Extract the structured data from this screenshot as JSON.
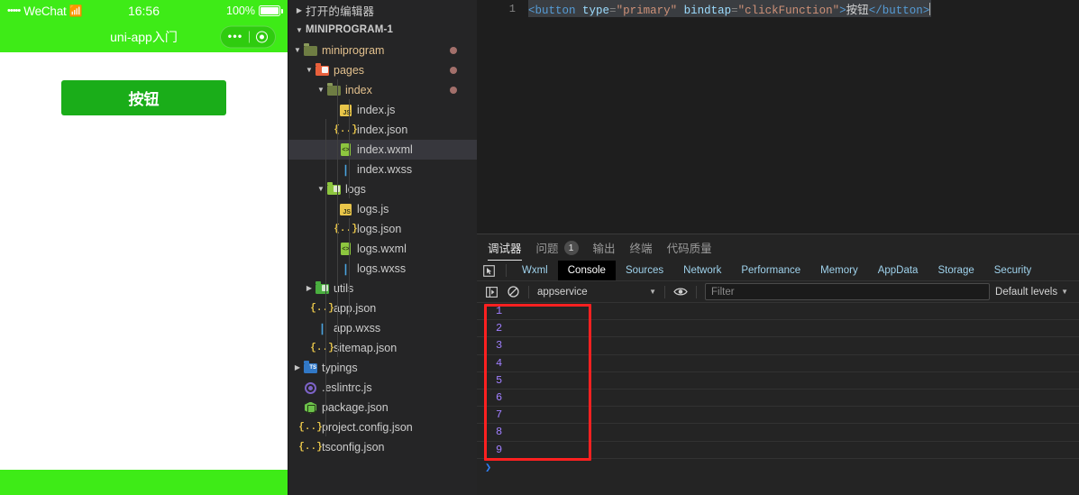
{
  "phone": {
    "status_bar": {
      "carrier_dots": "•••••",
      "carrier": "WeChat",
      "wifi_icon": "wifi-icon",
      "time": "16:56",
      "battery_percent": "100%",
      "battery_icon": "battery-full-icon"
    },
    "nav": {
      "title": "uni-app入门",
      "capsule_more_icon": "more-dots-icon",
      "capsule_close_icon": "target-circle-icon"
    },
    "button_label": "按钮",
    "colors": {
      "brand_green": "#3eeb17",
      "button_green": "#1aad19"
    }
  },
  "explorer": {
    "open_editors_label": "打开的编辑器",
    "project_label": "MINIPROGRAM-1",
    "tree": [
      {
        "label": "miniprogram",
        "icon": "folder-open-icon",
        "depth": 1,
        "type": "folder",
        "expanded": true,
        "modified": true,
        "selected": false
      },
      {
        "label": "pages",
        "icon": "folder-pages-icon",
        "depth": 2,
        "type": "folder",
        "expanded": true,
        "modified": true,
        "selected": false
      },
      {
        "label": "index",
        "icon": "folder-open-icon",
        "depth": 3,
        "type": "folder",
        "expanded": true,
        "modified": true,
        "selected": false
      },
      {
        "label": "index.js",
        "icon": "js-file-icon",
        "depth": 4,
        "type": "file",
        "selected": false
      },
      {
        "label": "index.json",
        "icon": "json-file-icon",
        "depth": 4,
        "type": "file",
        "selected": false
      },
      {
        "label": "index.wxml",
        "icon": "wxml-file-icon",
        "depth": 4,
        "type": "file",
        "selected": true
      },
      {
        "label": "index.wxss",
        "icon": "wxss-file-icon",
        "depth": 4,
        "type": "file",
        "selected": false
      },
      {
        "label": "logs",
        "icon": "folder-logs-icon",
        "depth": 3,
        "type": "folder",
        "expanded": true,
        "selected": false
      },
      {
        "label": "logs.js",
        "icon": "js-file-icon",
        "depth": 4,
        "type": "file",
        "selected": false
      },
      {
        "label": "logs.json",
        "icon": "json-file-icon",
        "depth": 4,
        "type": "file",
        "selected": false
      },
      {
        "label": "logs.wxml",
        "icon": "wxml-file-icon",
        "depth": 4,
        "type": "file",
        "selected": false
      },
      {
        "label": "logs.wxss",
        "icon": "wxss-file-icon",
        "depth": 4,
        "type": "file",
        "selected": false
      },
      {
        "label": "utils",
        "icon": "folder-utils-icon",
        "depth": 2,
        "type": "folder",
        "expanded": false,
        "selected": false
      },
      {
        "label": "app.json",
        "icon": "json-file-icon",
        "depth": 2,
        "type": "file",
        "selected": false
      },
      {
        "label": "app.wxss",
        "icon": "wxss-file-icon",
        "depth": 2,
        "type": "file",
        "selected": false
      },
      {
        "label": "sitemap.json",
        "icon": "json-file-icon",
        "depth": 2,
        "type": "file",
        "selected": false
      },
      {
        "label": "typings",
        "icon": "folder-ts-icon",
        "depth": 1,
        "type": "folder",
        "expanded": false,
        "selected": false
      },
      {
        "label": ".eslintrc.js",
        "icon": "eslint-icon",
        "depth": 1,
        "type": "file",
        "selected": false
      },
      {
        "label": "package.json",
        "icon": "npm-icon",
        "depth": 1,
        "type": "file",
        "selected": false
      },
      {
        "label": "project.config.json",
        "icon": "json-file-icon",
        "depth": 1,
        "type": "file",
        "selected": false
      },
      {
        "label": "tsconfig.json",
        "icon": "json-file-icon",
        "depth": 1,
        "type": "file",
        "selected": false
      }
    ]
  },
  "editor": {
    "line_number": "1",
    "tokens": [
      {
        "text": "<button",
        "cls": "tk-tag"
      },
      {
        "text": " ",
        "cls": "tk-plain"
      },
      {
        "text": "type",
        "cls": "tk-attr"
      },
      {
        "text": "=",
        "cls": "tk-punct"
      },
      {
        "text": "\"primary\"",
        "cls": "tk-str"
      },
      {
        "text": " ",
        "cls": "tk-plain"
      },
      {
        "text": "bindtap",
        "cls": "tk-attr"
      },
      {
        "text": "=",
        "cls": "tk-punct"
      },
      {
        "text": "\"clickFunction\"",
        "cls": "tk-str"
      },
      {
        "text": ">",
        "cls": "tk-tag"
      },
      {
        "text": "按钮",
        "cls": "tk-plain"
      },
      {
        "text": "</button>",
        "cls": "tk-tag"
      }
    ]
  },
  "devtools": {
    "panel_tabs": [
      {
        "label": "调试器",
        "active": true,
        "badge": null
      },
      {
        "label": "问题",
        "active": false,
        "badge": "1"
      },
      {
        "label": "输出",
        "active": false,
        "badge": null
      },
      {
        "label": "终端",
        "active": false,
        "badge": null
      },
      {
        "label": "代码质量",
        "active": false,
        "badge": null
      }
    ],
    "inspect_icon": "inspect-element-icon",
    "dt_tabs": [
      {
        "label": "Wxml",
        "active": false
      },
      {
        "label": "Console",
        "active": true
      },
      {
        "label": "Sources",
        "active": false
      },
      {
        "label": "Network",
        "active": false
      },
      {
        "label": "Performance",
        "active": false
      },
      {
        "label": "Memory",
        "active": false
      },
      {
        "label": "AppData",
        "active": false
      },
      {
        "label": "Storage",
        "active": false
      },
      {
        "label": "Security",
        "active": false
      }
    ],
    "console_toolbar": {
      "top_frame_icon": "console-sidebar-icon",
      "clear_icon": "clear-console-icon",
      "context": "appservice",
      "context_caret": "▼",
      "eye_icon": "live-expression-eye-icon",
      "filter_placeholder": "Filter",
      "filter_value": "",
      "levels_label": "Default levels",
      "levels_caret": "▼"
    },
    "console_output": [
      "1",
      "2",
      "3",
      "4",
      "5",
      "6",
      "7",
      "8",
      "9"
    ],
    "prompt_symbol": "❯",
    "annotation_color": "#ff2020"
  }
}
